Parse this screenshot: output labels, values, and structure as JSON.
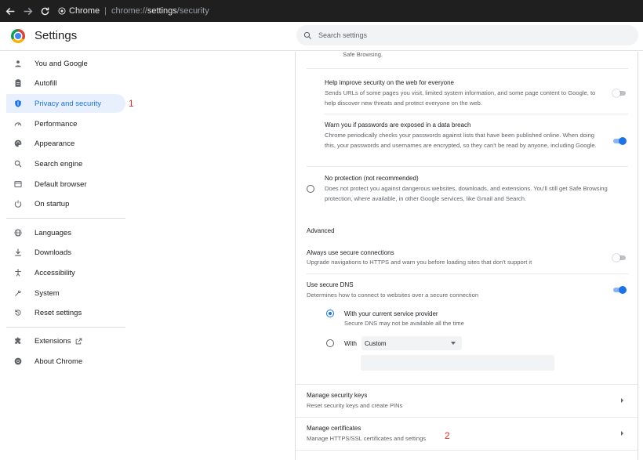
{
  "browser": {
    "chip_label": "Chrome",
    "separator": "|",
    "url_scheme": "chrome://",
    "url_host": "settings",
    "url_path": "/security",
    "icons": [
      "back-arrow-icon",
      "forward-arrow-icon",
      "reload-icon",
      "chrome-chip-icon"
    ]
  },
  "header": {
    "title": "Settings",
    "search_placeholder": "Search settings"
  },
  "sidebar": {
    "items": [
      {
        "label": "You and Google",
        "icon": "person-icon"
      },
      {
        "label": "Autofill",
        "icon": "clipboard-icon"
      },
      {
        "label": "Privacy and security",
        "icon": "shield-icon",
        "active": true
      },
      {
        "label": "Performance",
        "icon": "speedometer-icon"
      },
      {
        "label": "Appearance",
        "icon": "palette-icon"
      },
      {
        "label": "Search engine",
        "icon": "search-icon"
      },
      {
        "label": "Default browser",
        "icon": "browser-window-icon"
      },
      {
        "label": "On startup",
        "icon": "power-icon"
      },
      {
        "label": "Languages",
        "icon": "globe-icon"
      },
      {
        "label": "Downloads",
        "icon": "download-icon"
      },
      {
        "label": "Accessibility",
        "icon": "accessibility-icon"
      },
      {
        "label": "System",
        "icon": "wrench-icon"
      },
      {
        "label": "Reset settings",
        "icon": "reset-icon"
      },
      {
        "label": "Extensions",
        "icon": "puzzle-icon"
      },
      {
        "label": "About Chrome",
        "icon": "chrome-logo-icon"
      }
    ]
  },
  "annotations": {
    "a1": "1",
    "a2": "2"
  },
  "main": {
    "safe_browsing_tail": "Safe Browsing.",
    "help_improve": {
      "title": "Help improve security on the web for everyone",
      "desc": "Sends URLs of some pages you visit, limited system information, and some page content to Google, to help discover new threats and protect everyone on the web.",
      "enabled": false
    },
    "password_warn": {
      "title": "Warn you if passwords are exposed in a data breach",
      "desc": "Chrome periodically checks your passwords against lists that have been published online. When doing this, your passwords and usernames are encrypted, so they can't be read by anyone, including Google.",
      "enabled": true
    },
    "no_protection": {
      "title": "No protection (not recommended)",
      "desc": "Does not protect you against dangerous websites, downloads, and extensions. You'll still get Safe Browsing protection, where available, in other Google services, like Gmail and Search."
    },
    "advanced_heading": "Advanced",
    "secure_connections": {
      "title": "Always use secure connections",
      "desc": "Upgrade navigations to HTTPS and warn you before loading sites that don't support it",
      "enabled": false
    },
    "secure_dns": {
      "title": "Use secure DNS",
      "desc": "Determines how to connect to websites over a secure connection",
      "enabled": true,
      "option_current_title": "With your current service provider",
      "option_current_desc": "Secure DNS may not be available all the time",
      "option_with_label": "With",
      "provider_selected": "Custom"
    },
    "security_keys": {
      "title": "Manage security keys",
      "desc": "Reset security keys and create PINs"
    },
    "certificates": {
      "title": "Manage certificates",
      "desc": "Manage HTTPS/SSL certificates and settings"
    }
  },
  "colors": {
    "accent": "#1a73e8",
    "active_bg": "#e8f0fe",
    "annotation": "#d93025"
  }
}
